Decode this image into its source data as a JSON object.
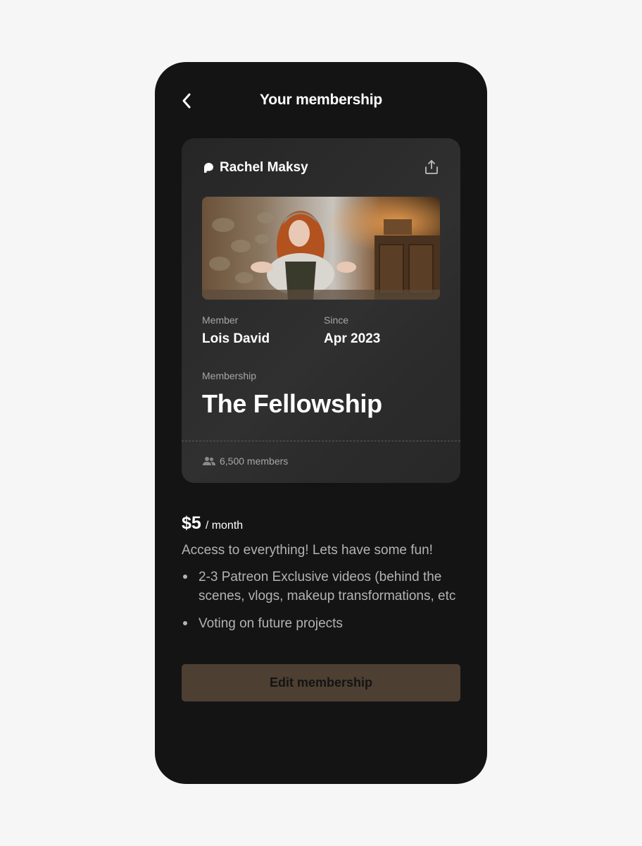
{
  "header": {
    "title": "Your membership",
    "back_icon": "chevron-left-icon"
  },
  "card": {
    "creator_icon": "patreon-logo-icon",
    "creator_name": "Rachel Maksy",
    "share_icon": "share-icon",
    "image_alt": "cover-photo",
    "member_label": "Member",
    "member_value": "Lois David",
    "since_label": "Since",
    "since_value": "Apr 2023",
    "membership_label": "Membership",
    "membership_value": "The Fellowship",
    "members_icon": "people-icon",
    "members_count": "6,500 members"
  },
  "pricing": {
    "price": "$5",
    "period": "/ month",
    "description": "Access to everything! Lets have some fun!",
    "benefits": [
      "2-3 Patreon Exclusive videos (behind the scenes, vlogs, makeup transformations, etc",
      "Voting on future projects"
    ]
  },
  "actions": {
    "edit_label": "Edit membership"
  },
  "colors": {
    "background": "#141414",
    "card": "#2b2b2b",
    "button": "#4d3f31",
    "text_primary": "#ffffff",
    "text_secondary": "#b3b3b3"
  }
}
